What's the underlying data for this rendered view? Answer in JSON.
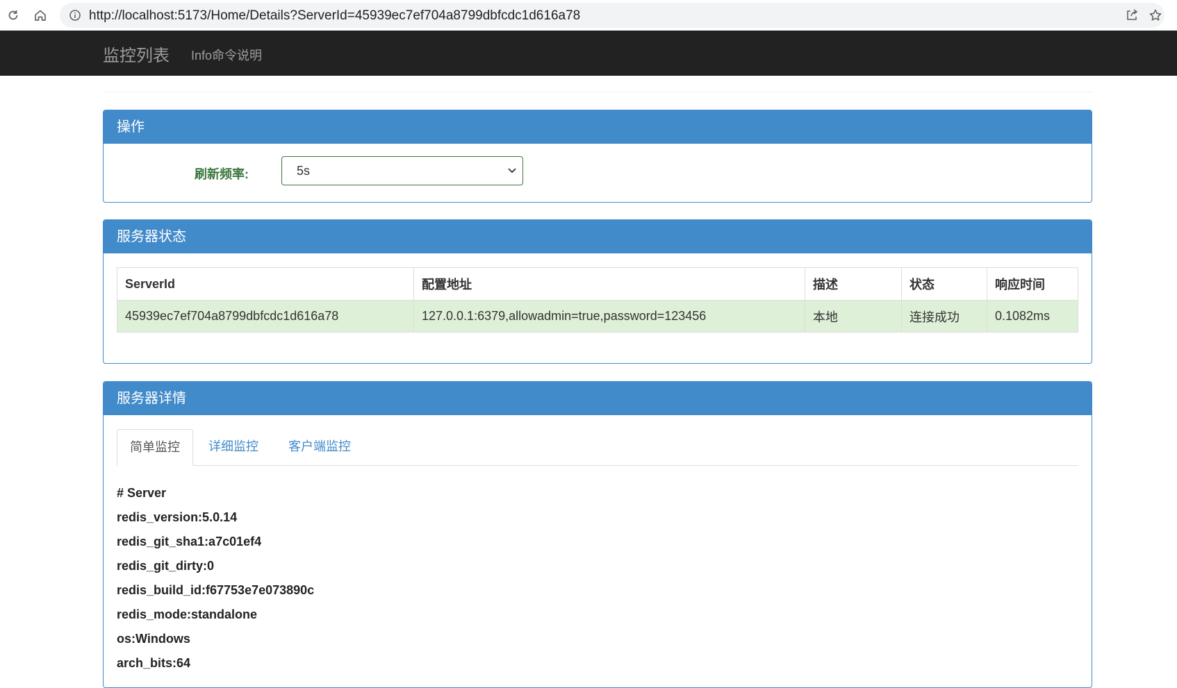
{
  "browser": {
    "url": "http://localhost:5173/Home/Details?ServerId=45939ec7ef704a8799dbfcdc1d616a78",
    "icons": [
      "reload-icon",
      "home-icon",
      "info-icon",
      "share-icon",
      "star-icon"
    ]
  },
  "navbar": {
    "brand": "监控列表",
    "link": "Info命令说明"
  },
  "operations": {
    "title": "操作",
    "refresh_label": "刷新频率:",
    "refresh_value": "5s"
  },
  "status": {
    "title": "服务器状态",
    "columns": [
      "ServerId",
      "配置地址",
      "描述",
      "状态",
      "响应时间"
    ],
    "rows": [
      [
        "45939ec7ef704a8799dbfcdc1d616a78",
        "127.0.0.1:6379,allowadmin=true,password=123456",
        "本地",
        "连接成功",
        "0.1082ms"
      ]
    ]
  },
  "details": {
    "title": "服务器详情",
    "tabs": [
      "简单监控",
      "详细监控",
      "客户端监控"
    ],
    "active_tab": 0,
    "lines": [
      "# Server",
      "redis_version:5.0.14",
      "redis_git_sha1:a7c01ef4",
      "redis_git_dirty:0",
      "redis_build_id:f67753e7e073890c",
      "redis_mode:standalone",
      "os:Windows",
      "arch_bits:64"
    ]
  },
  "colors": {
    "primary": "#428bca",
    "navbar": "#222222",
    "success_bg": "#dff0d8",
    "success_text": "#3c763d"
  }
}
